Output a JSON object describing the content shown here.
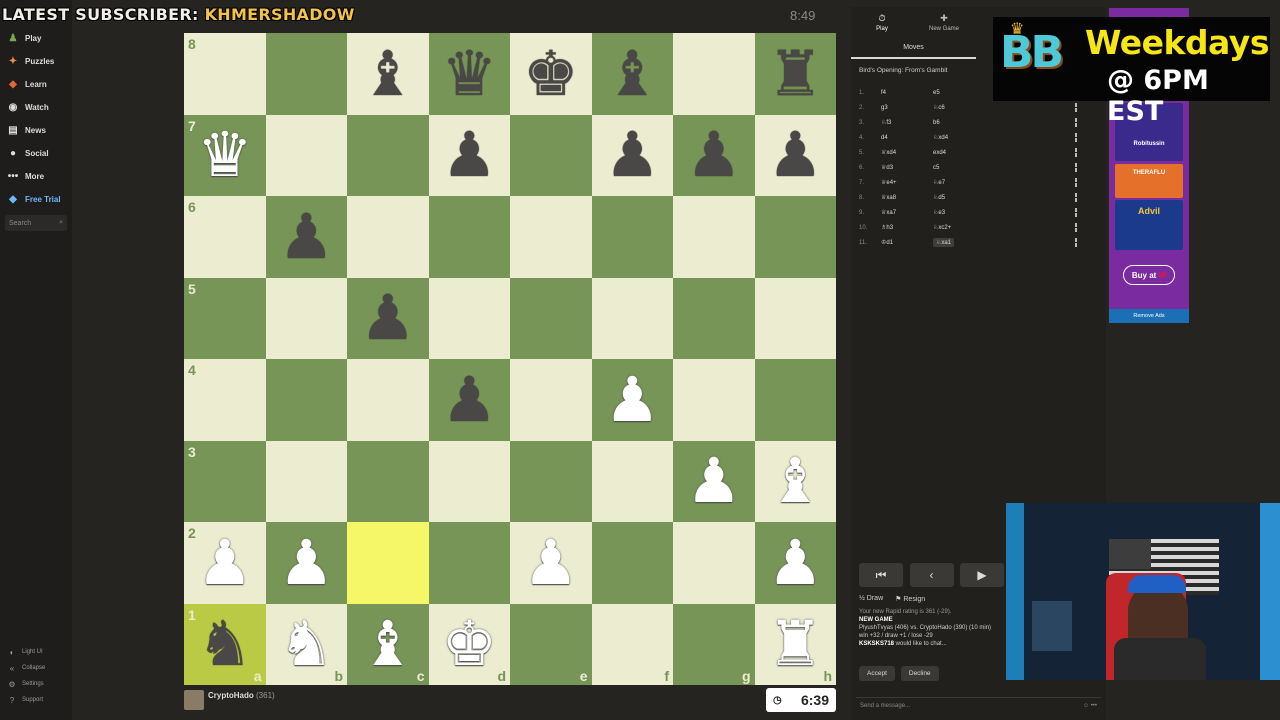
{
  "banner": {
    "prefix": "LATEST SUBSCRIBER: ",
    "name": "KHMERSHADOW"
  },
  "sidebar": {
    "items": [
      {
        "label": "Play",
        "icon": "play-icon",
        "glyph": "♟",
        "color": "#7fa650"
      },
      {
        "label": "Puzzles",
        "icon": "puzzle-icon",
        "glyph": "✦",
        "color": "#f38f3b"
      },
      {
        "label": "Learn",
        "icon": "learn-icon",
        "glyph": "◆",
        "color": "#e2683a"
      },
      {
        "label": "Watch",
        "icon": "watch-icon",
        "glyph": "◉",
        "color": "#dcdcdc"
      },
      {
        "label": "News",
        "icon": "news-icon",
        "glyph": "▤",
        "color": "#dcdcdc"
      },
      {
        "label": "Social",
        "icon": "social-icon",
        "glyph": "●",
        "color": "#dcdcdc"
      },
      {
        "label": "More",
        "icon": "more-icon",
        "glyph": "•••",
        "color": "#dcdcdc"
      },
      {
        "label": "Free Trial",
        "icon": "diamond-icon",
        "glyph": "◆",
        "color": "#6fb7ff"
      }
    ],
    "search_placeholder": "Search",
    "bottom": [
      {
        "label": "Light UI",
        "icon": "light-ui-icon",
        "glyph": "◐"
      },
      {
        "label": "Collapse",
        "icon": "collapse-icon",
        "glyph": "«"
      },
      {
        "label": "Settings",
        "icon": "settings-icon",
        "glyph": "⚙"
      },
      {
        "label": "Support",
        "icon": "support-icon",
        "glyph": "?"
      }
    ]
  },
  "top_timer": "8:49",
  "board": {
    "ranks": [
      "8",
      "7",
      "6",
      "5",
      "4",
      "3",
      "2",
      "1"
    ],
    "files": [
      "a",
      "b",
      "c",
      "d",
      "e",
      "f",
      "g",
      "h"
    ],
    "rows": [
      [
        "",
        "",
        "bB",
        "bQ",
        "bK",
        "bB",
        "",
        "bR"
      ],
      [
        "wQ",
        "",
        "",
        "bP",
        "",
        "bP",
        "bP",
        "bP"
      ],
      [
        "",
        "bP",
        "",
        "",
        "",
        "",
        "",
        ""
      ],
      [
        "",
        "",
        "bP",
        "",
        "",
        "",
        "",
        ""
      ],
      [
        "",
        "",
        "",
        "bP",
        "",
        "wP",
        "",
        ""
      ],
      [
        "",
        "",
        "",
        "",
        "",
        "",
        "wP",
        "wB"
      ],
      [
        "wP",
        "wP",
        "",
        "",
        "wP",
        "",
        "",
        "wP"
      ],
      [
        "bN",
        "wN",
        "wB",
        "wK",
        "",
        "",
        "",
        "wR"
      ]
    ],
    "highlight": [
      "c2",
      "a1"
    ]
  },
  "player": {
    "name": "CryptoHado",
    "rating": "(361)",
    "clock": "6:39"
  },
  "right_panel": {
    "tabs": [
      {
        "label": "Play",
        "icon": "clock-icon",
        "glyph": "⏱"
      },
      {
        "label": "New Game",
        "icon": "plus-icon",
        "glyph": "✚"
      }
    ],
    "moves_tab": "Moves",
    "opening": "Bird's Opening: From's Gambit",
    "moves": [
      {
        "n": "1.",
        "w": "f4",
        "b": "e5"
      },
      {
        "n": "2.",
        "w": "g3",
        "b": "♘c6"
      },
      {
        "n": "3.",
        "w": "♘f3",
        "b": "b6"
      },
      {
        "n": "4.",
        "w": "d4",
        "b": "♘xd4"
      },
      {
        "n": "5.",
        "w": "♕xd4",
        "b": "exd4"
      },
      {
        "n": "6.",
        "w": "♕d3",
        "b": "c5"
      },
      {
        "n": "7.",
        "w": "♕e4+",
        "b": "♘e7"
      },
      {
        "n": "8.",
        "w": "♕xa8",
        "b": "♘d5"
      },
      {
        "n": "9.",
        "w": "♕xa7",
        "b": "♘e3"
      },
      {
        "n": "10.",
        "w": "♗h3",
        "b": "♘xc2+"
      },
      {
        "n": "11.",
        "w": "♔d1",
        "b": "♘xa1"
      }
    ],
    "controls": [
      "⏮",
      "‹",
      "▶"
    ],
    "draw_label": "Draw",
    "resign_label": "Resign",
    "chat": {
      "line1": "Your new Rapid rating is 361 (-29).",
      "new_game": "NEW GAME",
      "match": "PlyushTvyas (406) vs. CryptoHado (390) (10 min)",
      "outcome": "win +32 / draw +1 / lose -29",
      "invite_user": "KSKSKS718",
      "invite_text": " would like to chat..."
    },
    "accept": "Accept",
    "decline": "Decline",
    "chat_placeholder": "Send a message..."
  },
  "ad": {
    "brand_line": "Robitussin",
    "product2": "THERAFLU",
    "product3": "Advil",
    "buy": "Buy at",
    "remove": "Remove Ads"
  },
  "promo": {
    "logo": "BB",
    "line1": "Weekdays",
    "line2": "@ 6PM EST"
  }
}
